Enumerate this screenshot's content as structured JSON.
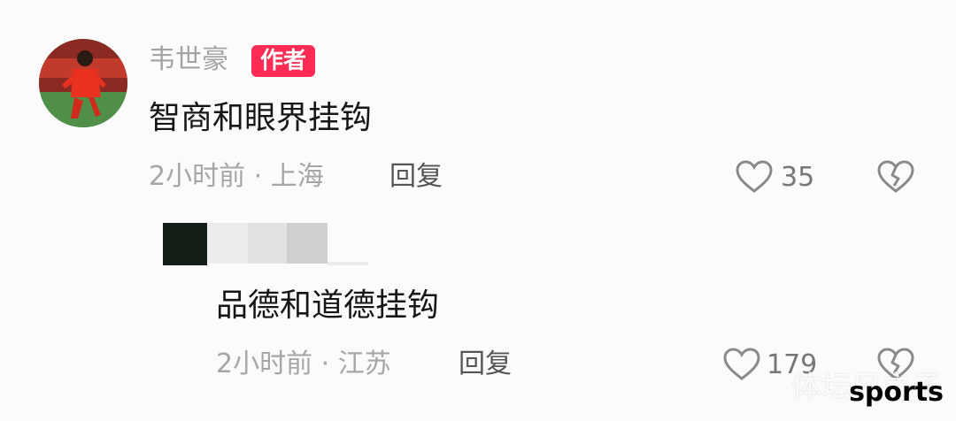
{
  "comment": {
    "author": "韦世豪",
    "badge": "作者",
    "text": "智商和眼界挂钩",
    "meta": "2小时前 · 上海",
    "reply_label": "回复",
    "like_count": "35"
  },
  "reply": {
    "text": "品德和道德挂钩",
    "meta": "2小时前 · 江苏",
    "reply_label": "回复",
    "like_count": "179"
  },
  "watermark": {
    "cn": "体坛风之子",
    "en": "sports"
  },
  "icons": {
    "like": "heart-outline-icon",
    "dislike": "broken-heart-icon"
  },
  "colors": {
    "badge_bg": "#fe2c55",
    "meta_text": "#a6a6a6",
    "comment_text": "#161616"
  }
}
